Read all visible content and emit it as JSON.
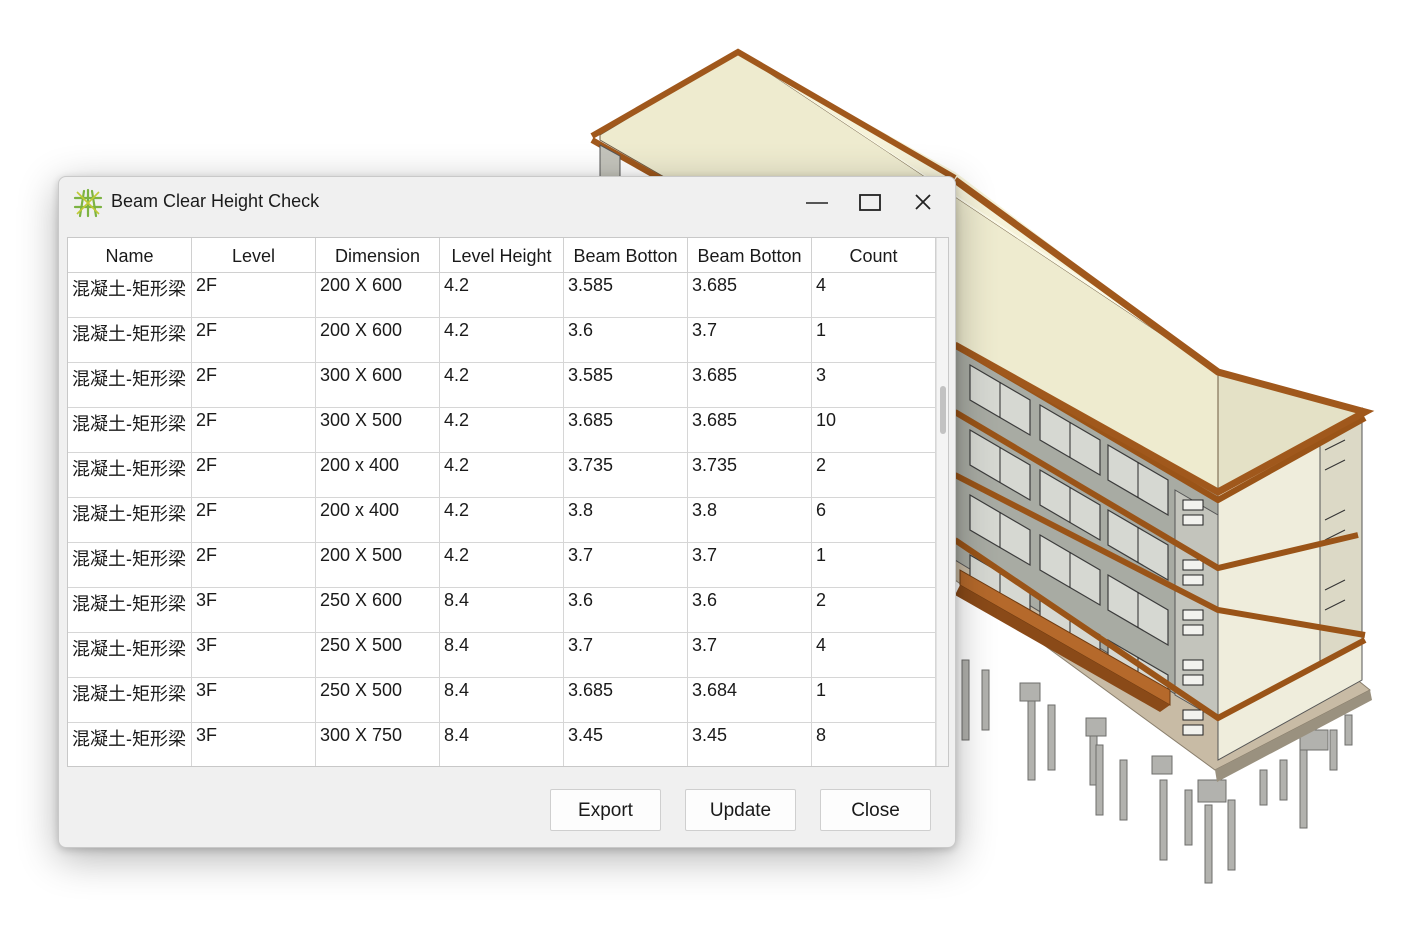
{
  "window": {
    "title": "Beam Clear Height Check",
    "icon": "bamboo-app-icon"
  },
  "titlebar_controls": [
    "minimize-icon",
    "maximize-icon",
    "close-icon"
  ],
  "table": {
    "columns": [
      "Name",
      "Level",
      "Dimension",
      "Level Height",
      "Beam Botton",
      "Beam Botton",
      "Count"
    ],
    "rows": [
      [
        "混凝土-矩形梁",
        "2F",
        "200 X 600",
        "4.2",
        "3.585",
        "3.685",
        "4"
      ],
      [
        "混凝土-矩形梁",
        "2F",
        "200 X 600",
        "4.2",
        "3.6",
        "3.7",
        "1"
      ],
      [
        "混凝土-矩形梁",
        "2F",
        "300 X 600",
        "4.2",
        "3.585",
        "3.685",
        "3"
      ],
      [
        "混凝土-矩形梁",
        "2F",
        "300 X 500",
        "4.2",
        "3.685",
        "3.685",
        "10"
      ],
      [
        "混凝土-矩形梁",
        "2F",
        "200 x 400",
        "4.2",
        "3.735",
        "3.735",
        "2"
      ],
      [
        "混凝土-矩形梁",
        "2F",
        "200 x 400",
        "4.2",
        "3.8",
        "3.8",
        "6"
      ],
      [
        "混凝土-矩形梁",
        "2F",
        "200 X 500",
        "4.2",
        "3.7",
        "3.7",
        "1"
      ],
      [
        "混凝土-矩形梁",
        "3F",
        "250 X 600",
        "8.4",
        "3.6",
        "3.6",
        "2"
      ],
      [
        "混凝土-矩形梁",
        "3F",
        "250 X 500",
        "8.4",
        "3.7",
        "3.7",
        "4"
      ],
      [
        "混凝土-矩形梁",
        "3F",
        "250 X 500",
        "8.4",
        "3.685",
        "3.684",
        "1"
      ],
      [
        "混凝土-矩形梁",
        "3F",
        "300 X 750",
        "8.4",
        "3.45",
        "3.45",
        "8"
      ]
    ]
  },
  "buttons": {
    "export": "Export",
    "update": "Update",
    "close": "Close"
  },
  "colors": {
    "roof": "#f6f3da",
    "fascia": "#a0581c",
    "wall": "#e2ded0",
    "wall_shadow": "#a4a69c",
    "window_bg": "#f0f0f0"
  }
}
